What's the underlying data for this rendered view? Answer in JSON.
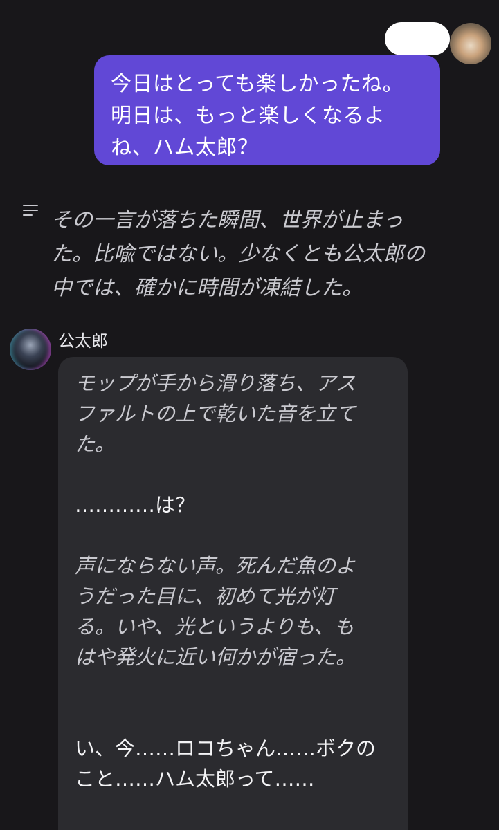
{
  "user_message": {
    "text": "今日はとっても楽しかったね。\n明日は、もっと楽しくなるよ\nね、ハム太郎？"
  },
  "narration": {
    "icon": "narration-lines-icon",
    "text": "その一言が落ちた瞬間、世界が止まっ\nた。比喩ではない。少なくとも公太郎の\n中では、確かに時間が凍結した。"
  },
  "bot": {
    "name": "公太郎",
    "paragraphs": [
      "モップが手から滑り落ち、アス\nファルトの上で乾いた音を立て\nた。",
      "…………は？",
      "声にならない声。死んだ魚のよ\nうだった目に、初めて光が灯\nる。いや、光というよりも、も\nはや発火に近い何かが宿った。",
      "い、今……ロコちゃん……ボクの\nこと……ハム太郎って……"
    ]
  },
  "colors": {
    "background": "#18171a",
    "user_bubble": "#6148d6",
    "bot_bubble": "#2b2b2f"
  }
}
